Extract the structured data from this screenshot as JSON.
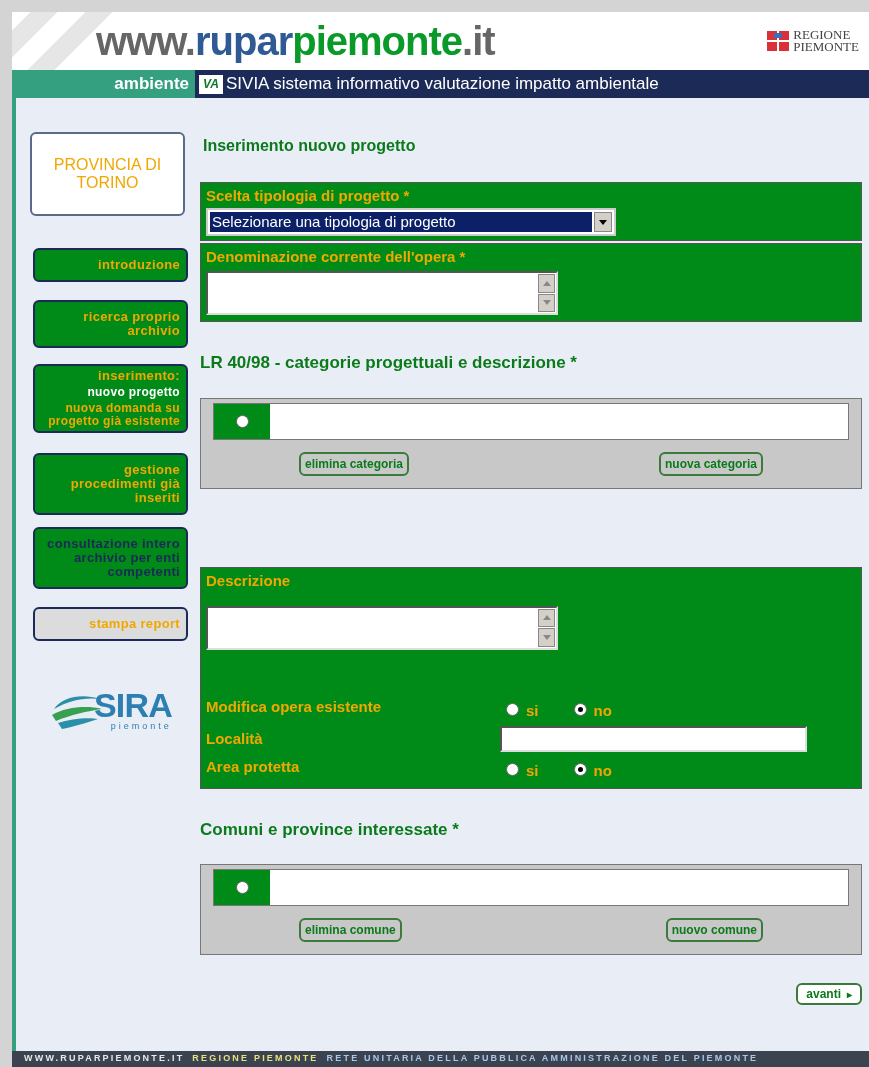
{
  "header": {
    "logo_parts": [
      {
        "text": "www.",
        "color": "#666666"
      },
      {
        "text": "rupar",
        "color": "#2f5a93"
      },
      {
        "text": "piemonte",
        "color": "#0a9a2a"
      },
      {
        "text": ".it",
        "color": "#666666"
      }
    ],
    "region_logo": [
      "REGIONE",
      "PIEMONTE"
    ]
  },
  "nav_bar": {
    "section": "ambiente",
    "app_badge": "VA",
    "app_title": "SIVIA sistema informativo valutazione impatto ambientale"
  },
  "sidebar": {
    "organization": "PROVINCIA DI TORINO",
    "items": [
      {
        "label": "introduzione",
        "kind": "menu",
        "disabled": false
      },
      {
        "label": "ricerca proprio archivio",
        "kind": "menu",
        "disabled": false
      },
      {
        "label": "inserimento:",
        "kind": "menu",
        "disabled": false,
        "children": [
          {
            "label": "nuovo progetto",
            "selected": true
          },
          {
            "label": "nuova domanda su progetto già esistente",
            "selected": false
          }
        ]
      },
      {
        "label": "gestione procedimenti già inseriti",
        "kind": "menu",
        "disabled": false
      },
      {
        "label": "consultazione intero archivio per enti competenti",
        "kind": "menu",
        "disabled": true
      },
      {
        "label": "stampa report",
        "kind": "report",
        "disabled": false
      }
    ],
    "sira_logo": {
      "name": "SIRA",
      "sub": "piemonte"
    }
  },
  "main": {
    "title": "Inserimento nuovo progetto",
    "project_type": {
      "label": "Scelta tipologia di progetto *",
      "value": "Selezionare una tipologia di progetto"
    },
    "work_name": {
      "label": "Denominazione corrente dell'opera *"
    },
    "categories": {
      "heading": "LR 40/98 - categorie progettuali e descrizione *",
      "rows": [
        {
          "selected": false
        }
      ],
      "buttons": [
        "elimina categoria",
        "nuova categoria"
      ]
    },
    "details": {
      "description_label": "Descrizione",
      "modifica": {
        "label": "Modifica opera esistente",
        "options": [
          {
            "label": "si",
            "selected": false
          },
          {
            "label": "no",
            "selected": true
          }
        ]
      },
      "localita": {
        "label": "Località"
      },
      "area": {
        "label": "Area protetta",
        "options": [
          {
            "label": "si",
            "selected": false
          },
          {
            "label": "no",
            "selected": true
          }
        ]
      }
    },
    "municipalities": {
      "heading": "Comuni e province interessate *",
      "rows": [
        {
          "selected": false
        }
      ],
      "buttons": [
        "elimina comune",
        "nuovo comune"
      ]
    },
    "next_button": {
      "label": "avanti",
      "icon": "▸"
    }
  },
  "footer": [
    {
      "text": "WWW.RUPARPIEMONTE.IT",
      "color": "#e8e8e8"
    },
    {
      "text": "REGIONE PIEMONTE",
      "color": "#e8e07a"
    },
    {
      "text": "RETE UNITARIA DELLA PUBBLICA AMMINISTRAZIONE DEL PIEMONTE",
      "color": "#a8c8e8"
    }
  ]
}
